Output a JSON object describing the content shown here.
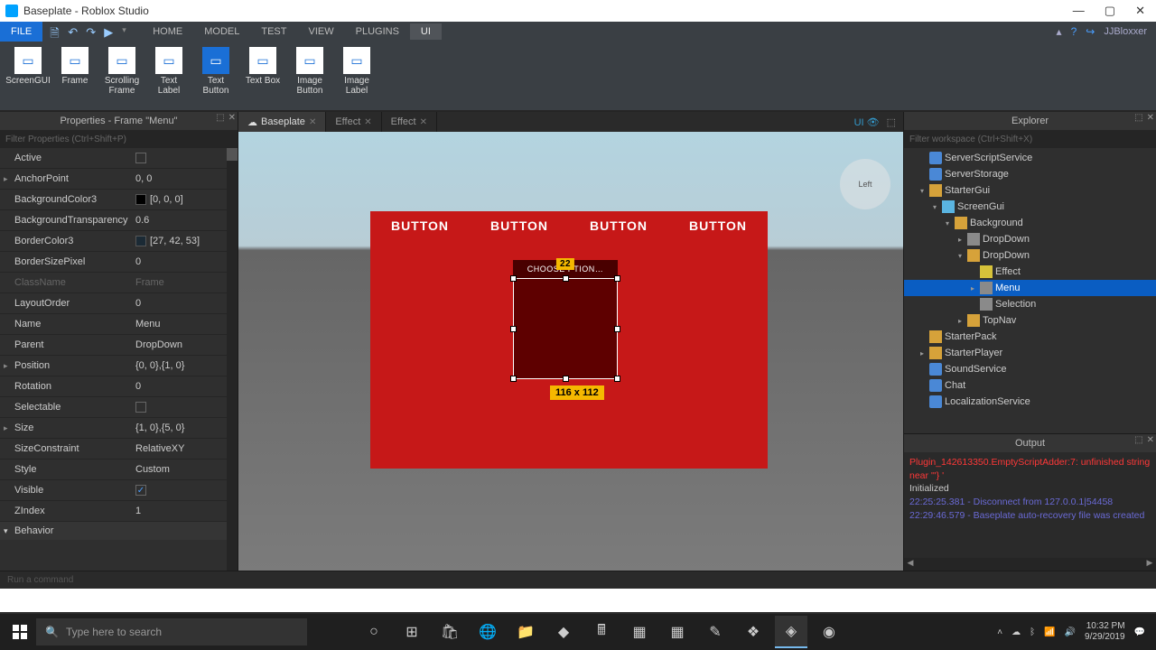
{
  "window": {
    "title": "Baseplate - Roblox Studio"
  },
  "menu": {
    "file": "FILE",
    "tabs": [
      "HOME",
      "MODEL",
      "TEST",
      "VIEW",
      "PLUGINS",
      "UI"
    ],
    "active": "UI",
    "user": "JJBloxxer"
  },
  "ribbon": [
    {
      "label": "ScreenGUI",
      "active": false
    },
    {
      "label": "Frame",
      "active": false
    },
    {
      "label": "Scrolling Frame",
      "active": false
    },
    {
      "label": "Text Label",
      "active": false
    },
    {
      "label": "Text Button",
      "active": true
    },
    {
      "label": "Text Box",
      "active": false
    },
    {
      "label": "Image Button",
      "active": false
    },
    {
      "label": "Image Label",
      "active": false
    }
  ],
  "properties": {
    "title": "Properties - Frame \"Menu\"",
    "filter_placeholder": "Filter Properties (Ctrl+Shift+P)",
    "rows": [
      {
        "name": "Active",
        "val": "",
        "kind": "chk",
        "checked": false
      },
      {
        "name": "AnchorPoint",
        "val": "0, 0",
        "exp": true
      },
      {
        "name": "BackgroundColor3",
        "val": "[0, 0, 0]",
        "swatch": "#000"
      },
      {
        "name": "BackgroundTransparency",
        "val": "0.6"
      },
      {
        "name": "BorderColor3",
        "val": "[27, 42, 53]",
        "swatch": "#1b2a35"
      },
      {
        "name": "BorderSizePixel",
        "val": "0"
      },
      {
        "name": "ClassName",
        "val": "Frame",
        "dim": true
      },
      {
        "name": "LayoutOrder",
        "val": "0"
      },
      {
        "name": "Name",
        "val": "Menu"
      },
      {
        "name": "Parent",
        "val": "DropDown"
      },
      {
        "name": "Position",
        "val": "{0, 0},{1, 0}",
        "exp": true
      },
      {
        "name": "Rotation",
        "val": "0"
      },
      {
        "name": "Selectable",
        "val": "",
        "kind": "chk",
        "checked": false
      },
      {
        "name": "Size",
        "val": "{1, 0},{5, 0}",
        "exp": true
      },
      {
        "name": "SizeConstraint",
        "val": "RelativeXY"
      },
      {
        "name": "Style",
        "val": "Custom"
      },
      {
        "name": "Visible",
        "val": "",
        "kind": "chk",
        "checked": true
      },
      {
        "name": "ZIndex",
        "val": "1"
      }
    ],
    "section": "Behavior"
  },
  "doctabs": [
    {
      "label": "Baseplate",
      "active": true,
      "icon": "cloud"
    },
    {
      "label": "Effect",
      "active": false
    },
    {
      "label": "Effect",
      "active": false
    }
  ],
  "viewport": {
    "ui_toggle": "UI",
    "widget": "Left",
    "buttons": [
      "BUTTON",
      "BUTTON",
      "BUTTON",
      "BUTTON"
    ],
    "dropdown_label": "CHOOSE   PTION…",
    "badge_top": "22",
    "size_badge": "116 x 112"
  },
  "explorer": {
    "title": "Explorer",
    "filter_placeholder": "Filter workspace (Ctrl+Shift+X)",
    "tree": [
      {
        "d": 1,
        "ico": "svc",
        "label": "ServerScriptService"
      },
      {
        "d": 1,
        "ico": "svc",
        "label": "ServerStorage"
      },
      {
        "d": 1,
        "ico": "fold",
        "label": "StarterGui",
        "exp": "▾"
      },
      {
        "d": 2,
        "ico": "gui",
        "label": "ScreenGui",
        "exp": "▾"
      },
      {
        "d": 3,
        "ico": "fold",
        "label": "Background",
        "exp": "▾"
      },
      {
        "d": 4,
        "ico": "frame",
        "label": "DropDown",
        "exp": "▸"
      },
      {
        "d": 4,
        "ico": "fold",
        "label": "DropDown",
        "exp": "▾"
      },
      {
        "d": 5,
        "ico": "eff",
        "label": "Effect"
      },
      {
        "d": 5,
        "ico": "frame",
        "label": "Menu",
        "sel": true,
        "exp": "▸"
      },
      {
        "d": 5,
        "ico": "frame",
        "label": "Selection"
      },
      {
        "d": 4,
        "ico": "fold",
        "label": "TopNav",
        "exp": "▸"
      },
      {
        "d": 1,
        "ico": "fold",
        "label": "StarterPack"
      },
      {
        "d": 1,
        "ico": "fold",
        "label": "StarterPlayer",
        "exp": "▸"
      },
      {
        "d": 1,
        "ico": "svc",
        "label": "SoundService"
      },
      {
        "d": 1,
        "ico": "svc",
        "label": "Chat"
      },
      {
        "d": 1,
        "ico": "svc",
        "label": "LocalizationService"
      }
    ]
  },
  "output": {
    "title": "Output",
    "lines": [
      {
        "cls": "c-err",
        "text": "Plugin_142613350.EmptyScriptAdder:7: unfinished string near '\"} '"
      },
      {
        "cls": "c-info",
        "text": "Initialized"
      },
      {
        "cls": "c-log",
        "text": "22:25:25.381 - Disconnect from 127.0.0.1|54458"
      },
      {
        "cls": "c-log",
        "text": "22:29:46.579 - Baseplate auto-recovery file was created"
      }
    ]
  },
  "cmd_placeholder": "Run a command",
  "taskbar": {
    "search_placeholder": "Type here to search",
    "time": "10:32 PM",
    "date": "9/29/2019"
  }
}
